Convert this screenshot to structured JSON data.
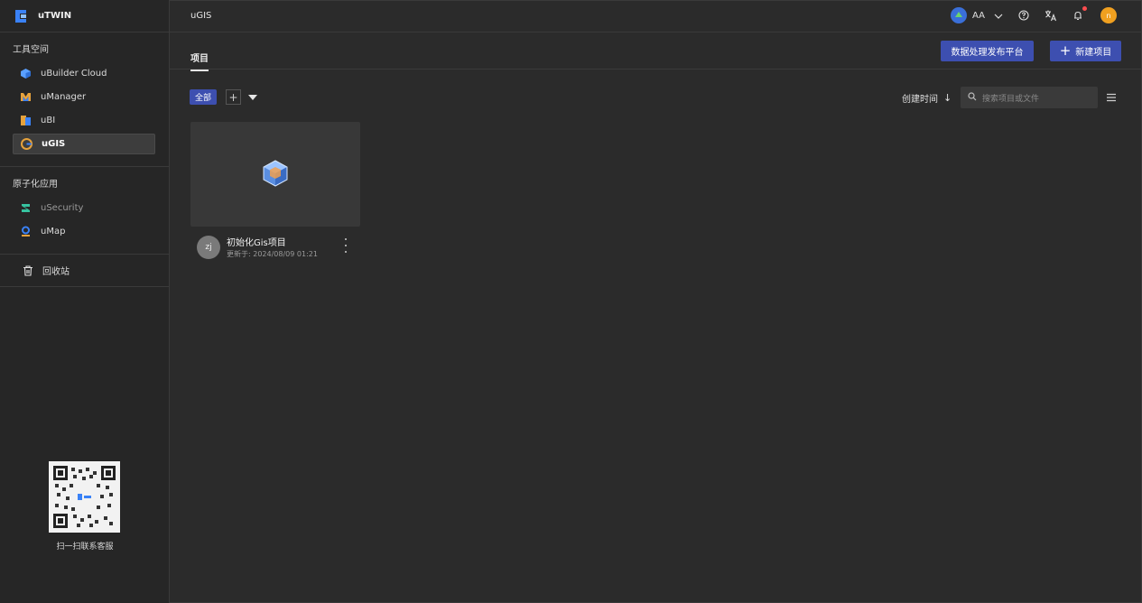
{
  "app": {
    "name": "uTWIN"
  },
  "sidebar": {
    "sections": [
      {
        "title": "工具空间",
        "items": [
          {
            "label": "uBuilder Cloud",
            "icon": "cube-icon",
            "active": false
          },
          {
            "label": "uManager",
            "icon": "manager-icon",
            "active": false
          },
          {
            "label": "uBI",
            "icon": "bi-icon",
            "active": false
          },
          {
            "label": "uGIS",
            "icon": "gis-icon",
            "active": true
          }
        ]
      },
      {
        "title": "原子化应用",
        "items": [
          {
            "label": "uSecurity",
            "icon": "security-icon",
            "active": false
          },
          {
            "label": "uMap",
            "icon": "map-pin-icon",
            "active": false
          }
        ]
      }
    ],
    "trash_label": "回收站",
    "qr_caption": "扫一扫联系客服"
  },
  "header": {
    "title": "uGIS",
    "org_name": "AA",
    "user_initial": "n"
  },
  "tabs": {
    "projects": "项目"
  },
  "actions": {
    "publish_label": "数据处理发布平台",
    "new_project_label": "新建项目"
  },
  "filter": {
    "all_label": "全部",
    "add_label": "+",
    "sort_label": "创建时间",
    "sort_arrow": "↓"
  },
  "search": {
    "placeholder": "搜索项目或文件"
  },
  "projects": [
    {
      "title": "初始化Gis项目",
      "updated": "更新于: 2024/08/09 01:21",
      "owner_initials": "zj"
    }
  ],
  "colors": {
    "accent": "#3d4fb0",
    "background": "#2b2b2b",
    "sidebar": "#262626",
    "user_avatar": "#f0a020",
    "notification_dot": "#ff4d4f"
  }
}
